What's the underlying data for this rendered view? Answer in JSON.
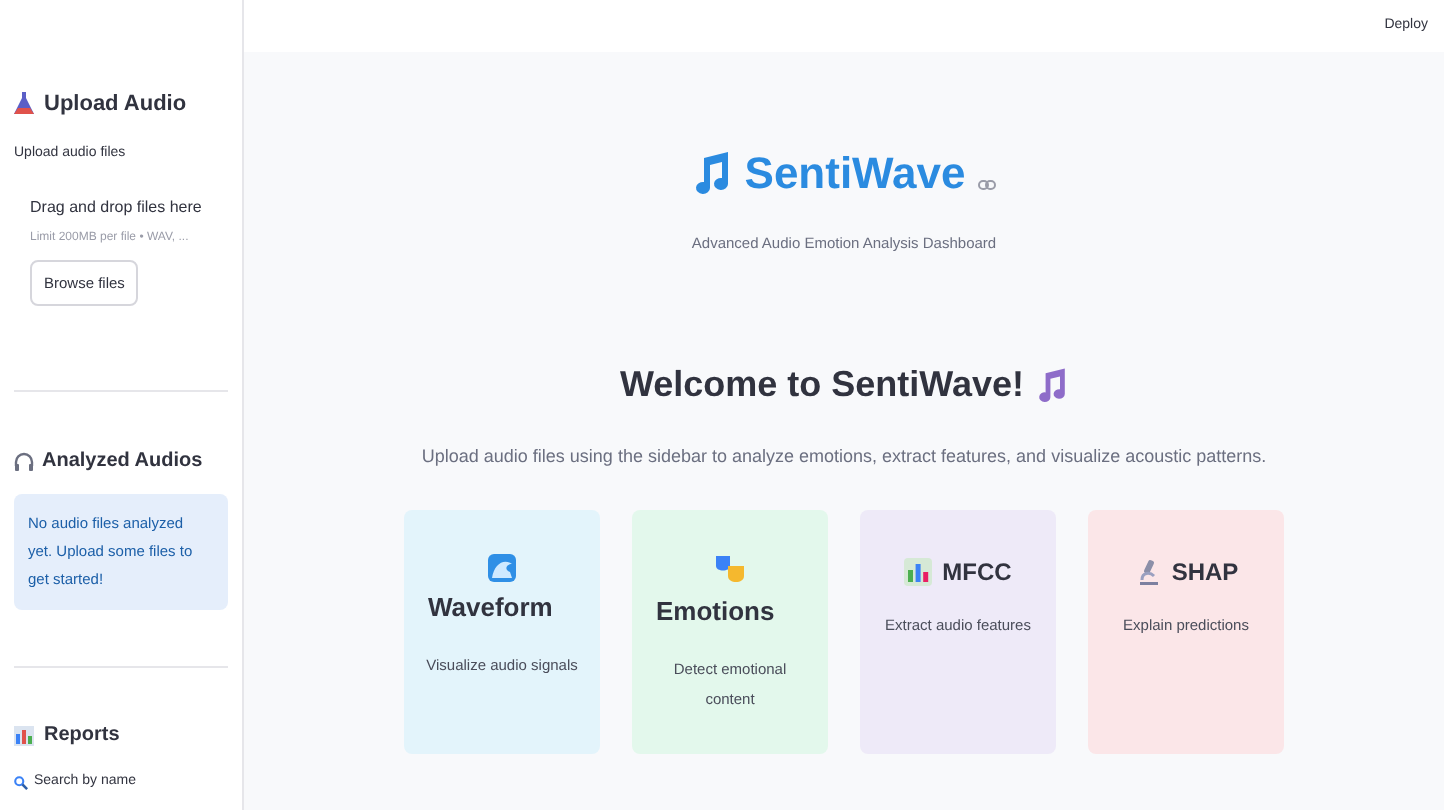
{
  "top_bar": {
    "deploy": "Deploy"
  },
  "sidebar": {
    "upload": {
      "heading": "Upload Audio",
      "label": "Upload audio files",
      "drop_text": "Drag and drop files here",
      "limit": "Limit 200MB per file • WAV, ...",
      "button": "Browse files"
    },
    "analyzed": {
      "heading": "Analyzed Audios",
      "info": "No audio files analyzed yet. Upload some files to get started!"
    },
    "reports": {
      "heading": "Reports",
      "search": "Search by name"
    }
  },
  "header": {
    "title": "SentiWave",
    "tagline": "Advanced Audio Emotion Analysis Dashboard"
  },
  "welcome": {
    "title": "Welcome to SentiWave!",
    "subtitle": "Upload audio files using the sidebar to analyze emotions, extract features, and visualize acoustic patterns."
  },
  "cards": [
    {
      "kind": "stacked",
      "title": "Waveform",
      "text": "Visualize audio signals",
      "color": "#e3f4fb"
    },
    {
      "kind": "stacked",
      "title": "Emotions",
      "text": "Detect emotional content",
      "color": "#e3f8ec"
    },
    {
      "kind": "inline",
      "title": "MFCC",
      "text": "Extract audio features",
      "color": "#eeeaf8"
    },
    {
      "kind": "inline",
      "title": "SHAP",
      "text": "Explain predictions",
      "color": "#fbe6e8"
    }
  ]
}
